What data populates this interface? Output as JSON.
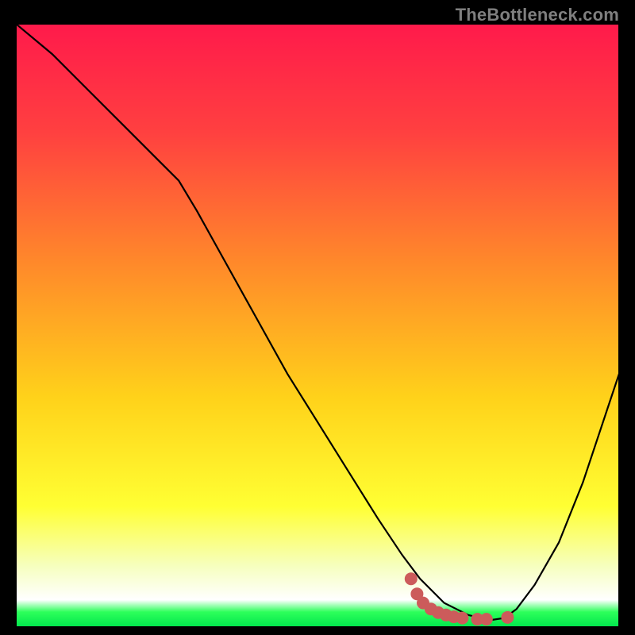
{
  "watermark": "TheBottleneck.com",
  "chart_data": {
    "type": "line",
    "title": "",
    "xlabel": "",
    "ylabel": "",
    "xlim": [
      0,
      100
    ],
    "ylim": [
      0,
      100
    ],
    "grid": false,
    "legend": false,
    "background_gradient": {
      "direction": "vertical",
      "stops": [
        {
          "offset": 0.0,
          "color": "#ff1a4b"
        },
        {
          "offset": 0.18,
          "color": "#ff4040"
        },
        {
          "offset": 0.4,
          "color": "#ff8a2a"
        },
        {
          "offset": 0.62,
          "color": "#ffd21a"
        },
        {
          "offset": 0.8,
          "color": "#ffff33"
        },
        {
          "offset": 0.9,
          "color": "#f6ffc0"
        },
        {
          "offset": 0.955,
          "color": "#ffffff"
        },
        {
          "offset": 0.975,
          "color": "#2dff5a"
        },
        {
          "offset": 1.0,
          "color": "#00e64d"
        }
      ]
    },
    "series": [
      {
        "name": "curve",
        "stroke": "#000000",
        "stroke_width": 2.2,
        "x": [
          0,
          6,
          12,
          18,
          24,
          27,
          30,
          35,
          40,
          45,
          50,
          55,
          60,
          64,
          67,
          69,
          71,
          73,
          75,
          77,
          79,
          81,
          83,
          86,
          90,
          94,
          98,
          100
        ],
        "y": [
          100,
          95,
          89,
          83,
          77,
          74,
          69,
          60,
          51,
          42,
          34,
          26,
          18,
          12,
          8,
          6,
          4,
          3,
          2,
          1.5,
          1.2,
          1.5,
          3,
          7,
          14,
          24,
          36,
          42
        ]
      }
    ],
    "markers": {
      "name": "highlight-dots",
      "color": "#cc5b5b",
      "radius": 8,
      "points": [
        {
          "x": 65.5,
          "y": 8.0
        },
        {
          "x": 66.5,
          "y": 5.5
        },
        {
          "x": 67.5,
          "y": 4.0
        },
        {
          "x": 68.8,
          "y": 3.0
        },
        {
          "x": 70.0,
          "y": 2.4
        },
        {
          "x": 71.3,
          "y": 2.0
        },
        {
          "x": 72.6,
          "y": 1.7
        },
        {
          "x": 74.0,
          "y": 1.5
        },
        {
          "x": 76.5,
          "y": 1.3
        },
        {
          "x": 78.0,
          "y": 1.3
        },
        {
          "x": 81.5,
          "y": 1.6
        }
      ]
    }
  }
}
